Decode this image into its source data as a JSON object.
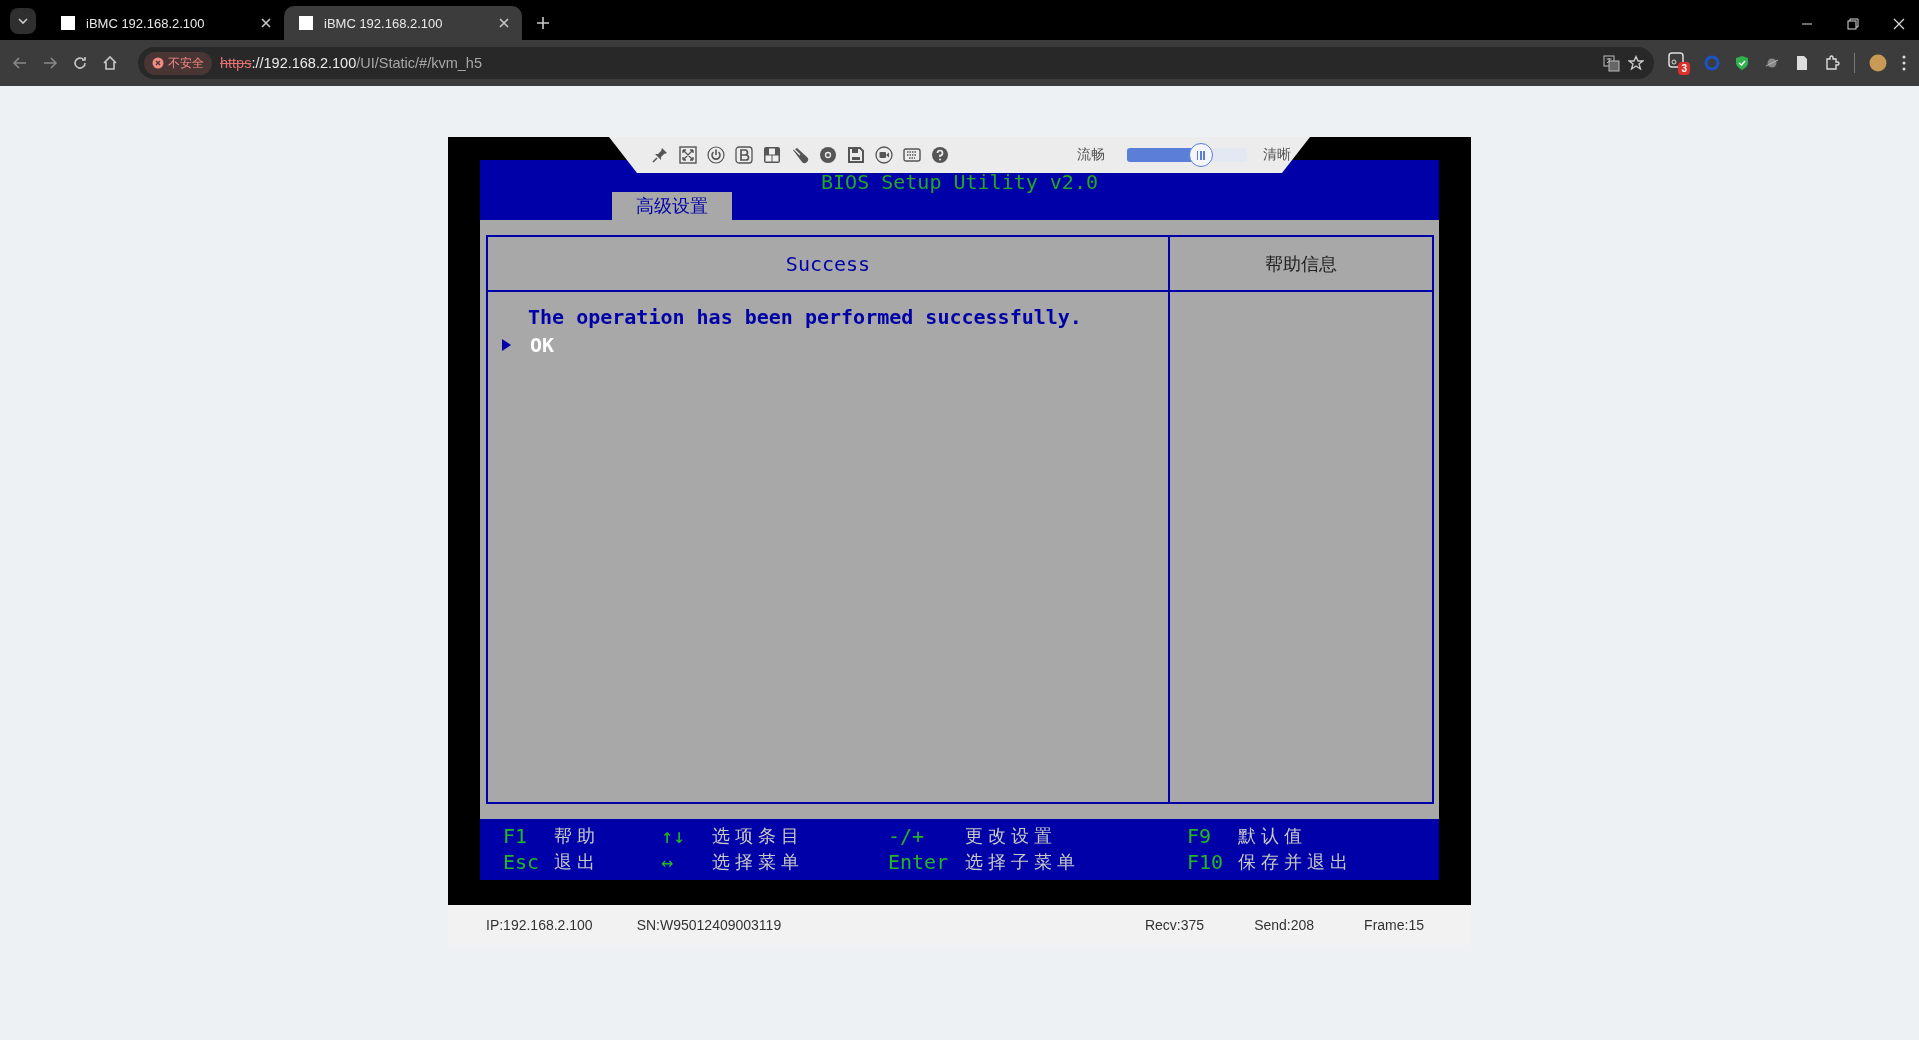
{
  "browser": {
    "tabs": [
      {
        "title": "iBMC 192.168.2.100",
        "selected": false
      },
      {
        "title": "iBMC 192.168.2.100",
        "selected": true
      }
    ],
    "security_label": "不安全",
    "url": {
      "scheme": "https",
      "host": "://192.168.2.100",
      "path": "/UI/Static/#/kvm_h5"
    },
    "extension_badge": "3"
  },
  "kvm": {
    "toolbar": {
      "quality_low_label": "流畅",
      "quality_high_label": "清晰",
      "quality": {
        "level": 0.62
      }
    },
    "bios": {
      "title": "BIOS Setup Utility v2.0",
      "tab": "高级设置",
      "panel_title": "Success",
      "help_title": "帮助信息",
      "message": "The operation has been performed successfully.",
      "options": [
        {
          "label": "OK",
          "selected": true
        }
      ],
      "keys": [
        {
          "key": "F1",
          "action": "帮助"
        },
        {
          "key": "↑↓",
          "action": "选项条目"
        },
        {
          "key": "-/+",
          "action": "更改设置"
        },
        {
          "key": "F9",
          "action": "默认值"
        },
        {
          "key": "Esc",
          "action": "退出"
        },
        {
          "key": "↔",
          "action": "选择菜单"
        },
        {
          "key": "Enter",
          "action": "选择子菜单"
        },
        {
          "key": "F10",
          "action": "保存并退出"
        }
      ]
    }
  },
  "status_bar": {
    "ip": "IP:192.168.2.100",
    "sn": "SN:W95012409003119",
    "recv": "Recv:375",
    "send": "Send:208",
    "frame": "Frame:15"
  }
}
